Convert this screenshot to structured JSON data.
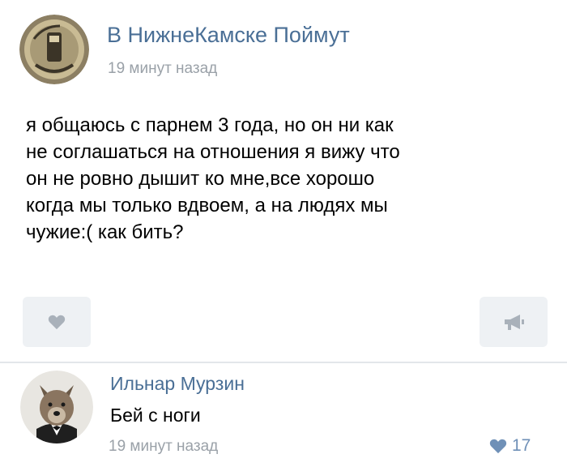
{
  "post": {
    "group_name": "В НижнеКамске Поймут",
    "time": "19 минут назад",
    "avatar_icon": "group-logo-icon",
    "text_lines": [
      "я общаюсь с парнем 3 года, но он ни как",
      "не соглашаться на отношения я вижу что",
      "он не ровно дышит ко мне,все хорошо",
      "когда мы только вдвоем, а на людях мы",
      "чужие:( как бить?"
    ],
    "like_icon": "heart-icon",
    "share_icon": "megaphone-icon"
  },
  "comment": {
    "author": "Ильнар Мурзин",
    "text": "Бей с ноги",
    "time": "19 минут назад",
    "likes": "17",
    "avatar_icon": "wolf-avatar-icon",
    "like_icon": "heart-icon"
  },
  "colors": {
    "link_blue": "#4a6f96",
    "meta_gray": "#9aa1a8",
    "button_bg": "#eef1f4",
    "icon_gray": "#a9b1ba",
    "like_blue": "#6f90b7"
  }
}
